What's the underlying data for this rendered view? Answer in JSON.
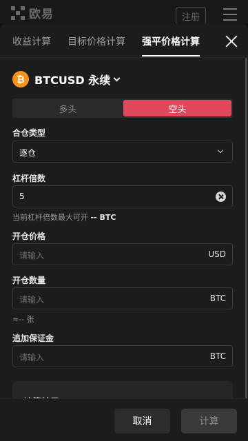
{
  "header": {
    "logo_text": "欧易",
    "register_label": "注册"
  },
  "tabs": [
    {
      "label": "收益计算",
      "active": false
    },
    {
      "label": "目标价格计算",
      "active": false
    },
    {
      "label": "强平价格计算",
      "active": true
    }
  ],
  "product": {
    "icon_glyph": "₿",
    "name": "BTCUSD 永续"
  },
  "side": {
    "long_label": "多头",
    "short_label": "空头",
    "selected": "空头",
    "short_color": "#e0485c"
  },
  "form": {
    "margin_type": {
      "label": "合仓类型",
      "value": "逐仓"
    },
    "leverage": {
      "label": "杠杆倍数",
      "value": "5"
    },
    "max_open_hint": {
      "prefix": "当前杠杆倍数最大可开",
      "value": "-- BTC"
    },
    "open_price": {
      "label": "开仓价格",
      "placeholder": "请输入",
      "unit": "USD"
    },
    "open_amount": {
      "label": "开仓数量",
      "placeholder": "请输入",
      "unit": "BTC"
    },
    "amount_hint": "≈-- 张",
    "add_margin": {
      "label": "追加保证金",
      "placeholder": "请输入",
      "unit": "BTC"
    }
  },
  "result": {
    "title": "计算结果"
  },
  "footer": {
    "cancel_label": "取消",
    "calculate_label": "计算"
  },
  "colors": {
    "accent_short": "#e0485c",
    "btc_orange": "#f7931a",
    "background": "#1c1c1c"
  }
}
